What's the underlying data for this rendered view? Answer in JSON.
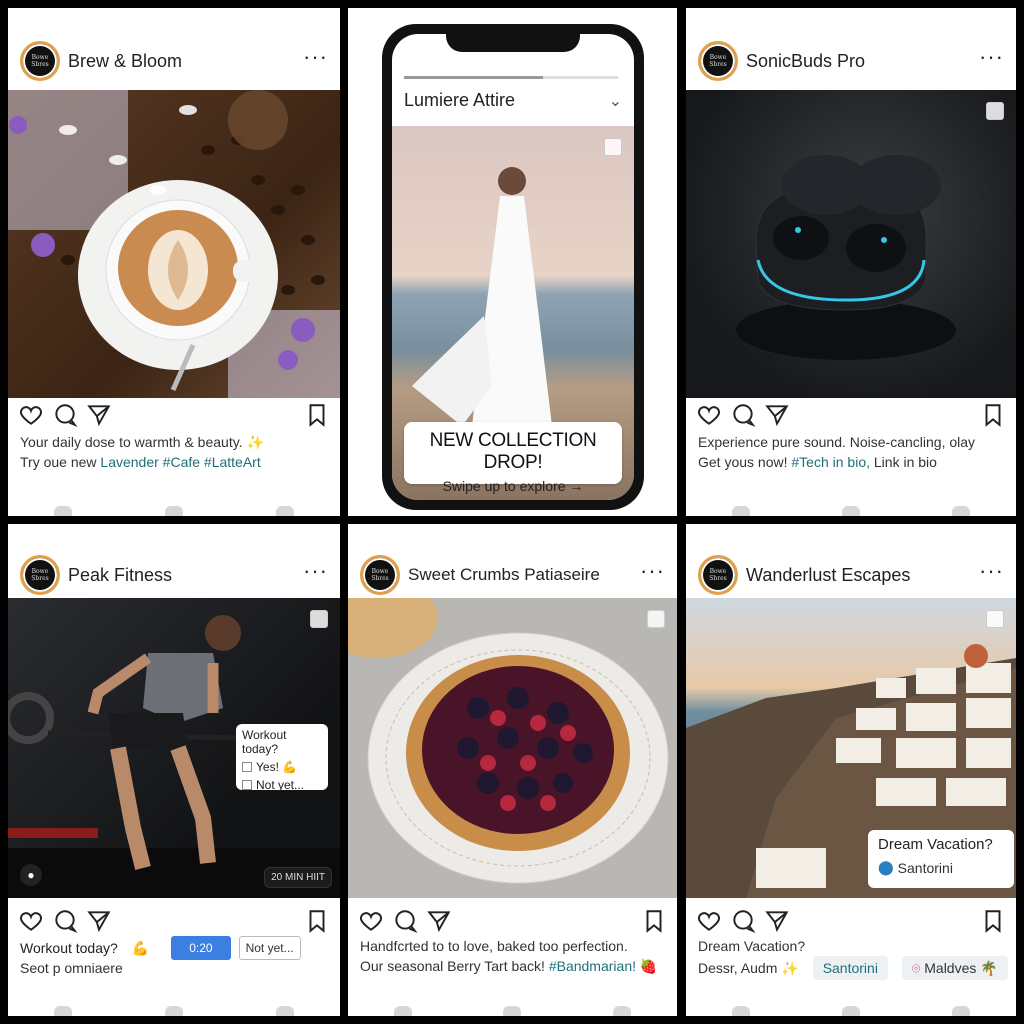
{
  "posts": [
    {
      "account": "Brew & Bloom",
      "avatar_text": "Bowe Sbres",
      "caption1": "Your daily dose to warmth & beauty. ✨",
      "caption2_prefix": "Try oue new ",
      "caption2_tags": "Lavender #Cafe #LatteArt"
    },
    {
      "account": "Lumiere Attire",
      "banner_title": "NEW COLLECTION DROP!",
      "banner_sub": "Swipe up to explore →"
    },
    {
      "account": "SonicBuds Pro",
      "avatar_text": "Bowe Sbres",
      "caption1": "Experience pure sound. Noise-cancling, olay",
      "caption2_prefix": "Get yous now! ",
      "caption2_tags": "#Tech in bio,",
      "caption2_suffix": " Link in bio"
    },
    {
      "account": "Peak Fitness",
      "avatar_text": "Bowe Sbres",
      "poll_q": "Workout today?",
      "poll_a": "Yes! 💪",
      "poll_b": "Not yet...",
      "timer": "20 MIN HIIT",
      "caption1": "Workout today?",
      "caption1_emoji": "💪",
      "caption_btn": "0:20",
      "caption_alt": "Not yet...",
      "caption2": "Seot p omniaere"
    },
    {
      "account": "Sweet Crumbs Patiaseire",
      "avatar_text": "Bowe Sbres",
      "caption1": "Handfcrted to to love, baked too perfection.",
      "caption2_prefix": "Our seasonal Berry Tart back! ",
      "caption2_tags": "#Bandmarian!",
      "caption2_emoji": "🍓"
    },
    {
      "account": "Wanderlust Escapes",
      "avatar_text": "Bowe Sbres",
      "overlay_q": "Dream Vacation?",
      "overlay_loc": "Santorini",
      "caption1": "Dream Vacation?",
      "caption2": "Dessr, Audm ✨",
      "chip1": "Santorini",
      "chip2": "Maldves 🌴"
    }
  ],
  "colors": {
    "avatar_ring": "#e0a14a",
    "tag": "#1f6f7a",
    "button_blue": "#3b7fe0"
  }
}
